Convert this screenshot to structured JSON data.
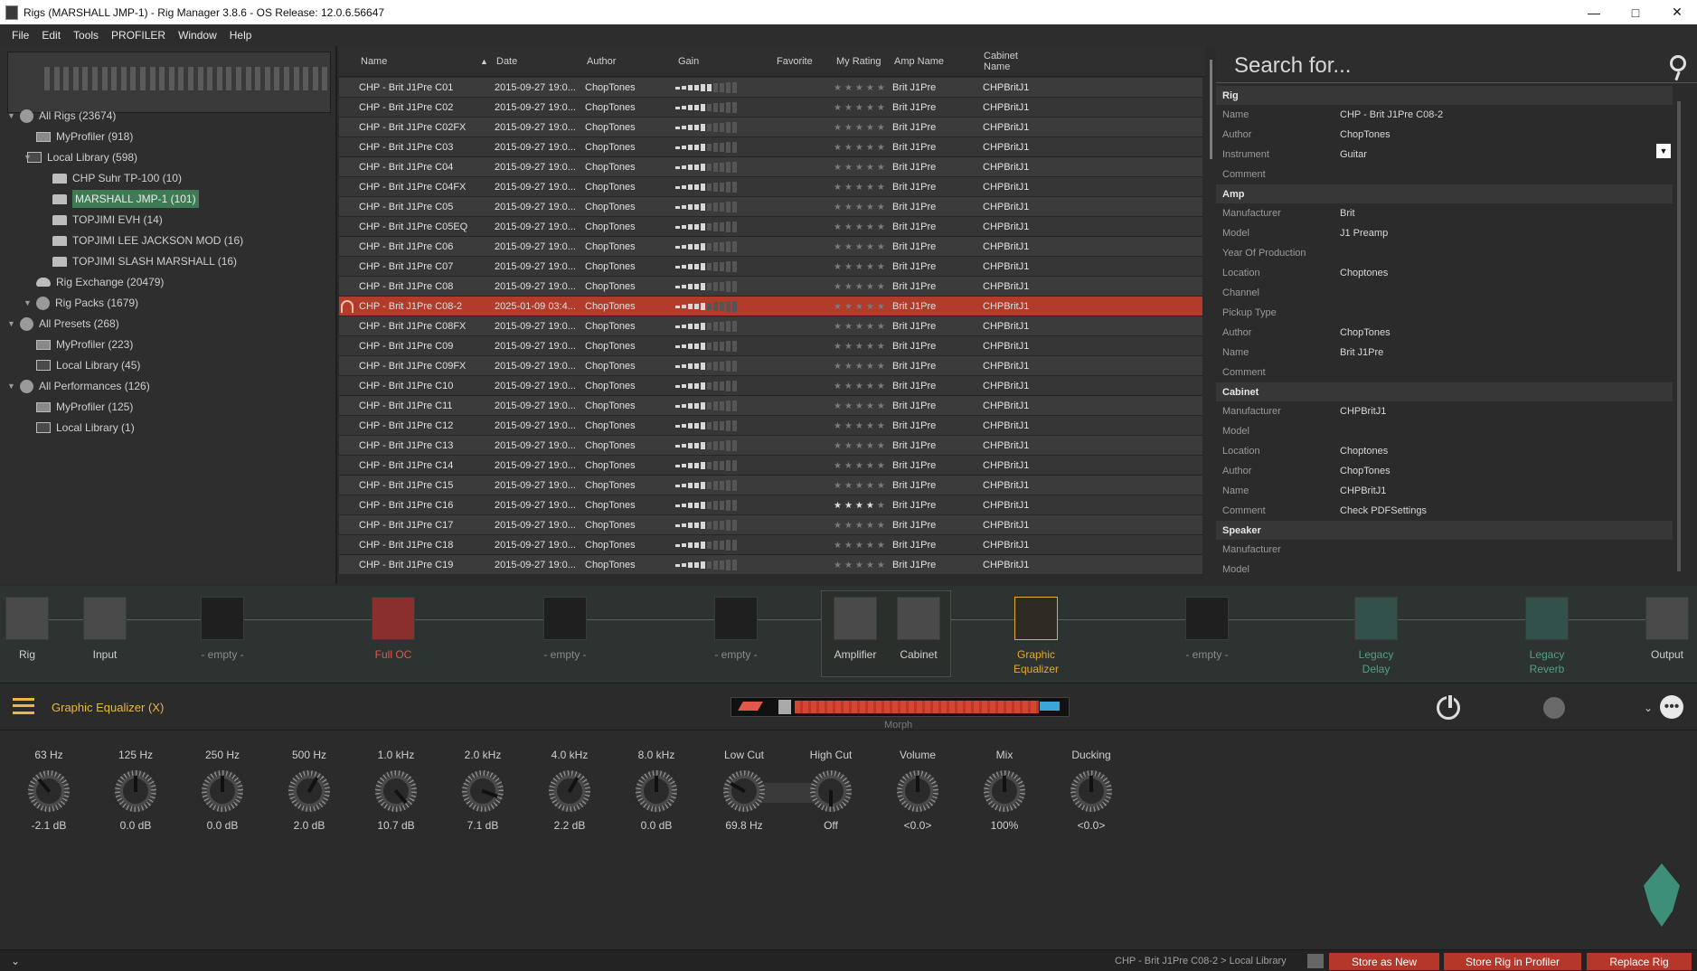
{
  "window": {
    "title": "Rigs (MARSHALL JMP-1) - Rig Manager 3.8.6 - OS Release: 12.0.6.56647"
  },
  "menu": [
    "File",
    "Edit",
    "Tools",
    "PROFILER",
    "Window",
    "Help"
  ],
  "tree": [
    {
      "label": "All Rigs (23674)",
      "icon": "globe-icon"
    },
    {
      "label": "MyProfiler (918)",
      "icon": "device-icon"
    },
    {
      "label": "Local Library (598)",
      "icon": "library-icon"
    },
    {
      "label": "CHP Suhr TP-100 (10)",
      "icon": "folder-icon"
    },
    {
      "label": "MARSHALL JMP-1 (101)",
      "icon": "folder-icon",
      "selected": true
    },
    {
      "label": "TOPJIMI EVH (14)",
      "icon": "folder-icon"
    },
    {
      "label": "TOPJIMI LEE JACKSON MOD (16)",
      "icon": "folder-icon"
    },
    {
      "label": "TOPJIMI SLASH MARSHALL (16)",
      "icon": "folder-icon"
    },
    {
      "label": "Rig Exchange (20479)",
      "icon": "cloud-icon"
    },
    {
      "label": "Rig Packs (1679)",
      "icon": "globe-icon"
    },
    {
      "label": "All Presets (268)",
      "icon": "globe-icon"
    },
    {
      "label": "MyProfiler (223)",
      "icon": "device-icon"
    },
    {
      "label": "Local Library (45)",
      "icon": "library-icon"
    },
    {
      "label": "All Performances (126)",
      "icon": "globe-icon"
    },
    {
      "label": "MyProfiler (125)",
      "icon": "device-icon"
    },
    {
      "label": "Local Library (1)",
      "icon": "library-icon"
    }
  ],
  "list": {
    "headers": {
      "name": "Name",
      "date": "Date",
      "author": "Author",
      "gain": "Gain",
      "favorite": "Favorite",
      "rating": "My Rating",
      "amp": "Amp Name",
      "cabinet": "Cabinet Name"
    },
    "rows": [
      {
        "name": "CHP - Brit J1Pre C01",
        "date": "2015-09-27 19:0...",
        "author": "ChopTones",
        "gain": 0.6,
        "stars": 0,
        "amp": "Brit J1Pre",
        "cab": "CHPBritJ1"
      },
      {
        "name": "CHP - Brit J1Pre C02",
        "date": "2015-09-27 19:0...",
        "author": "ChopTones",
        "gain": 0.5,
        "stars": 0,
        "amp": "Brit J1Pre",
        "cab": "CHPBritJ1"
      },
      {
        "name": "CHP - Brit J1Pre C02FX",
        "date": "2015-09-27 19:0...",
        "author": "ChopTones",
        "gain": 0.5,
        "stars": 0,
        "amp": "Brit J1Pre",
        "cab": "CHPBritJ1"
      },
      {
        "name": "CHP - Brit J1Pre C03",
        "date": "2015-09-27 19:0...",
        "author": "ChopTones",
        "gain": 0.5,
        "stars": 0,
        "amp": "Brit J1Pre",
        "cab": "CHPBritJ1"
      },
      {
        "name": "CHP - Brit J1Pre C04",
        "date": "2015-09-27 19:0...",
        "author": "ChopTones",
        "gain": 0.45,
        "stars": 0,
        "amp": "Brit J1Pre",
        "cab": "CHPBritJ1"
      },
      {
        "name": "CHP - Brit J1Pre C04FX",
        "date": "2015-09-27 19:0...",
        "author": "ChopTones",
        "gain": 0.45,
        "stars": 0,
        "amp": "Brit J1Pre",
        "cab": "CHPBritJ1"
      },
      {
        "name": "CHP - Brit J1Pre C05",
        "date": "2015-09-27 19:0...",
        "author": "ChopTones",
        "gain": 0.45,
        "stars": 0,
        "amp": "Brit J1Pre",
        "cab": "CHPBritJ1"
      },
      {
        "name": "CHP - Brit J1Pre C05EQ",
        "date": "2015-09-27 19:0...",
        "author": "ChopTones",
        "gain": 0.45,
        "stars": 0,
        "amp": "Brit J1Pre",
        "cab": "CHPBritJ1"
      },
      {
        "name": "CHP - Brit J1Pre C06",
        "date": "2015-09-27 19:0...",
        "author": "ChopTones",
        "gain": 0.45,
        "stars": 0,
        "amp": "Brit J1Pre",
        "cab": "CHPBritJ1"
      },
      {
        "name": "CHP - Brit J1Pre C07",
        "date": "2015-09-27 19:0...",
        "author": "ChopTones",
        "gain": 0.45,
        "stars": 0,
        "amp": "Brit J1Pre",
        "cab": "CHPBritJ1"
      },
      {
        "name": "CHP - Brit J1Pre C08",
        "date": "2015-09-27 19:0...",
        "author": "ChopTones",
        "gain": 0.45,
        "stars": 0,
        "amp": "Brit J1Pre",
        "cab": "CHPBritJ1"
      },
      {
        "name": "CHP - Brit J1Pre C08-2",
        "date": "2025-01-09 03:4...",
        "author": "ChopTones",
        "gain": 0.45,
        "stars": 0,
        "amp": "Brit J1Pre",
        "cab": "CHPBritJ1",
        "selected": true
      },
      {
        "name": "CHP - Brit J1Pre C08FX",
        "date": "2015-09-27 19:0...",
        "author": "ChopTones",
        "gain": 0.45,
        "stars": 0,
        "amp": "Brit J1Pre",
        "cab": "CHPBritJ1"
      },
      {
        "name": "CHP - Brit J1Pre C09",
        "date": "2015-09-27 19:0...",
        "author": "ChopTones",
        "gain": 0.45,
        "stars": 0,
        "amp": "Brit J1Pre",
        "cab": "CHPBritJ1"
      },
      {
        "name": "CHP - Brit J1Pre C09FX",
        "date": "2015-09-27 19:0...",
        "author": "ChopTones",
        "gain": 0.45,
        "stars": 0,
        "amp": "Brit J1Pre",
        "cab": "CHPBritJ1"
      },
      {
        "name": "CHP - Brit J1Pre C10",
        "date": "2015-09-27 19:0...",
        "author": "ChopTones",
        "gain": 0.45,
        "stars": 0,
        "amp": "Brit J1Pre",
        "cab": "CHPBritJ1"
      },
      {
        "name": "CHP - Brit J1Pre C11",
        "date": "2015-09-27 19:0...",
        "author": "ChopTones",
        "gain": 0.45,
        "stars": 0,
        "amp": "Brit J1Pre",
        "cab": "CHPBritJ1"
      },
      {
        "name": "CHP - Brit J1Pre C12",
        "date": "2015-09-27 19:0...",
        "author": "ChopTones",
        "gain": 0.45,
        "stars": 0,
        "amp": "Brit J1Pre",
        "cab": "CHPBritJ1"
      },
      {
        "name": "CHP - Brit J1Pre C13",
        "date": "2015-09-27 19:0...",
        "author": "ChopTones",
        "gain": 0.45,
        "stars": 0,
        "amp": "Brit J1Pre",
        "cab": "CHPBritJ1"
      },
      {
        "name": "CHP - Brit J1Pre C14",
        "date": "2015-09-27 19:0...",
        "author": "ChopTones",
        "gain": 0.45,
        "stars": 0,
        "amp": "Brit J1Pre",
        "cab": "CHPBritJ1"
      },
      {
        "name": "CHP - Brit J1Pre C15",
        "date": "2015-09-27 19:0...",
        "author": "ChopTones",
        "gain": 0.45,
        "stars": 0,
        "amp": "Brit J1Pre",
        "cab": "CHPBritJ1"
      },
      {
        "name": "CHP - Brit J1Pre C16",
        "date": "2015-09-27 19:0...",
        "author": "ChopTones",
        "gain": 0.45,
        "stars": 4,
        "amp": "Brit J1Pre",
        "cab": "CHPBritJ1"
      },
      {
        "name": "CHP - Brit J1Pre C17",
        "date": "2015-09-27 19:0...",
        "author": "ChopTones",
        "gain": 0.45,
        "stars": 0,
        "amp": "Brit J1Pre",
        "cab": "CHPBritJ1"
      },
      {
        "name": "CHP - Brit J1Pre C18",
        "date": "2015-09-27 19:0...",
        "author": "ChopTones",
        "gain": 0.45,
        "stars": 0,
        "amp": "Brit J1Pre",
        "cab": "CHPBritJ1"
      },
      {
        "name": "CHP - Brit J1Pre C19",
        "date": "2015-09-27 19:0...",
        "author": "ChopTones",
        "gain": 0.45,
        "stars": 0,
        "amp": "Brit J1Pre",
        "cab": "CHPBritJ1"
      }
    ]
  },
  "props": {
    "search_placeholder": "Search for...",
    "sections": [
      {
        "title": "Rig",
        "rows": [
          [
            "Name",
            "CHP - Brit J1Pre C08-2"
          ],
          [
            "Author",
            "ChopTones"
          ],
          [
            "Instrument",
            "Guitar"
          ],
          [
            "Comment",
            ""
          ]
        ]
      },
      {
        "title": "Amp",
        "rows": [
          [
            "Manufacturer",
            "Brit"
          ],
          [
            "Model",
            "J1 Preamp"
          ],
          [
            "Year Of Production",
            ""
          ],
          [
            "Location",
            "Choptones"
          ],
          [
            "Channel",
            ""
          ],
          [
            "Pickup Type",
            ""
          ],
          [
            "Author",
            "ChopTones"
          ],
          [
            "Name",
            "Brit J1Pre"
          ],
          [
            "Comment",
            ""
          ]
        ]
      },
      {
        "title": "Cabinet",
        "rows": [
          [
            "Manufacturer",
            "CHPBritJ1"
          ],
          [
            "Model",
            ""
          ],
          [
            "Location",
            "Choptones"
          ],
          [
            "Author",
            "ChopTones"
          ],
          [
            "Name",
            "CHPBritJ1"
          ],
          [
            "Comment",
            "Check PDFSettings"
          ]
        ]
      },
      {
        "title": "Speaker",
        "rows": [
          [
            "Manufacturer",
            ""
          ],
          [
            "Model",
            ""
          ]
        ]
      }
    ]
  },
  "chain": [
    {
      "label": "Rig",
      "style": "gray",
      "icon": "guitar-icon"
    },
    {
      "label": "Input",
      "style": "gray",
      "icon": "input-arrow-icon"
    },
    {
      "label": "- empty -",
      "style": "empty",
      "icon": ""
    },
    {
      "label": "Full OC",
      "style": "red",
      "icon": "distortion-icon"
    },
    {
      "label": "- empty -",
      "style": "empty",
      "icon": ""
    },
    {
      "label": "- empty -",
      "style": "empty",
      "icon": ""
    },
    {
      "label": "Amplifier",
      "style": "gray",
      "icon": "amplifier-icon"
    },
    {
      "label": "Cabinet",
      "style": "gray",
      "icon": "cabinet-icon"
    },
    {
      "label": "Graphic Equalizer",
      "style": "orange",
      "icon": "eq-icon"
    },
    {
      "label": "- empty -",
      "style": "empty",
      "icon": ""
    },
    {
      "label": "Legacy Delay",
      "style": "green",
      "icon": "delay-icon"
    },
    {
      "label": "Legacy Reverb",
      "style": "green",
      "icon": "reverb-icon"
    },
    {
      "label": "Output",
      "style": "gray",
      "icon": "output-arrow-icon"
    }
  ],
  "effect": {
    "title": "Graphic Equalizer (X)",
    "morph_label": "Morph"
  },
  "knobs": [
    {
      "label": "63 Hz",
      "value": "-2.1 dB"
    },
    {
      "label": "125 Hz",
      "value": "0.0 dB"
    },
    {
      "label": "250 Hz",
      "value": "0.0 dB"
    },
    {
      "label": "500 Hz",
      "value": "2.0 dB"
    },
    {
      "label": "1.0 kHz",
      "value": "10.7 dB"
    },
    {
      "label": "2.0 kHz",
      "value": "7.1 dB"
    },
    {
      "label": "4.0 kHz",
      "value": "2.2 dB"
    },
    {
      "label": "8.0 kHz",
      "value": "0.0 dB"
    },
    {
      "label": "Low Cut",
      "value": "69.8 Hz"
    },
    {
      "label": "High Cut",
      "value": "Off"
    },
    {
      "label": "Volume",
      "value": "<0.0>"
    },
    {
      "label": "Mix",
      "value": "100%"
    },
    {
      "label": "Ducking",
      "value": "<0.0>"
    }
  ],
  "status": {
    "path": "CHP - Brit J1Pre C08-2 > Local Library",
    "store_new": "Store as New",
    "store_profiler": "Store Rig in Profiler",
    "replace": "Replace Rig"
  }
}
